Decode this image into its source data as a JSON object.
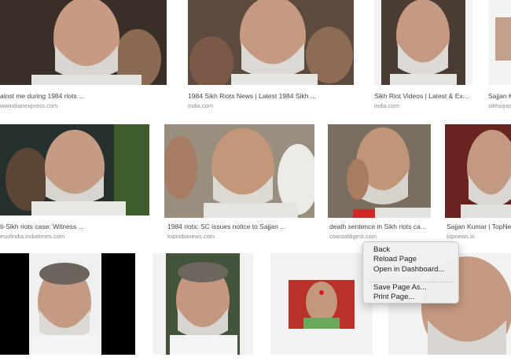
{
  "results": [
    {
      "caption": "ainst me during 1984 riots ...",
      "source": "wwindianexpress.com"
    },
    {
      "caption": "1984 Sikh Riots News | Latest 1984 Sikh ...",
      "source": "india.com"
    },
    {
      "caption": "Sikh Riot Videos | Latest & Ex...",
      "source": "india.com"
    },
    {
      "caption": "Sajjan K",
      "source": "sikhsiyasat"
    },
    {
      "caption": "ti-Sikh riots case: Witness ...",
      "source": "esofindia.indiatimes.com"
    },
    {
      "caption": "1984 riots: SC issues notice to Sajjan ...",
      "source": "topindianews.com"
    },
    {
      "caption": "death sentence in Sikh riots ca...",
      "source": "coastaldigest.com"
    },
    {
      "caption": "Sajjan Kumar | TopNe",
      "source": "topnews.in"
    }
  ],
  "context_menu": {
    "items": [
      "Back",
      "Reload Page",
      "Open in Dashboard...",
      "Save Page As...",
      "Print Page..."
    ]
  },
  "colors": {
    "menu_bg": "#f0f0f0",
    "caption": "#444444",
    "source": "#8a8a8a"
  }
}
